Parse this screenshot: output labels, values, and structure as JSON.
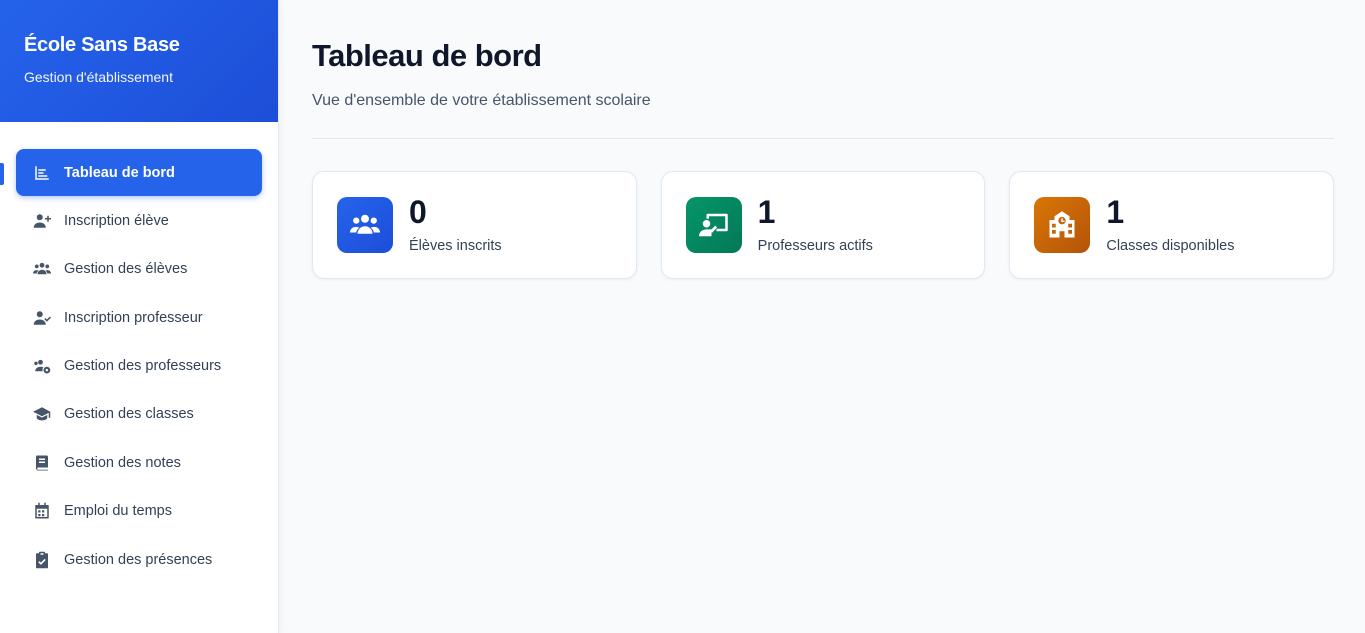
{
  "brand": {
    "title": "École Sans Base",
    "subtitle": "Gestion d'établissement"
  },
  "nav": [
    {
      "label": "Tableau de bord",
      "icon": "chart-icon",
      "active": true
    },
    {
      "label": "Inscription élève",
      "icon": "user-plus-icon"
    },
    {
      "label": "Gestion des élèves",
      "icon": "users-icon"
    },
    {
      "label": "Inscription professeur",
      "icon": "user-check-icon"
    },
    {
      "label": "Gestion des professeurs",
      "icon": "users-cog-icon"
    },
    {
      "label": "Gestion des classes",
      "icon": "graduation-cap-icon"
    },
    {
      "label": "Gestion des notes",
      "icon": "book-icon"
    },
    {
      "label": "Emploi du temps",
      "icon": "calendar-icon"
    },
    {
      "label": "Gestion des présences",
      "icon": "clipboard-check-icon"
    }
  ],
  "main": {
    "title": "Tableau de bord",
    "subtitle": "Vue d'ensemble de votre établissement scolaire"
  },
  "stats": [
    {
      "value": "0",
      "label": "Élèves inscrits",
      "icon": "users-icon",
      "color": "#2563eb"
    },
    {
      "value": "1",
      "label": "Professeurs actifs",
      "icon": "chalkboard-teacher-icon",
      "color": "#059669"
    },
    {
      "value": "1",
      "label": "Classes disponibles",
      "icon": "school-icon",
      "color": "#d97706"
    }
  ],
  "colors": {
    "primary": "#2563eb",
    "green": "#059669",
    "amber": "#d97706"
  }
}
